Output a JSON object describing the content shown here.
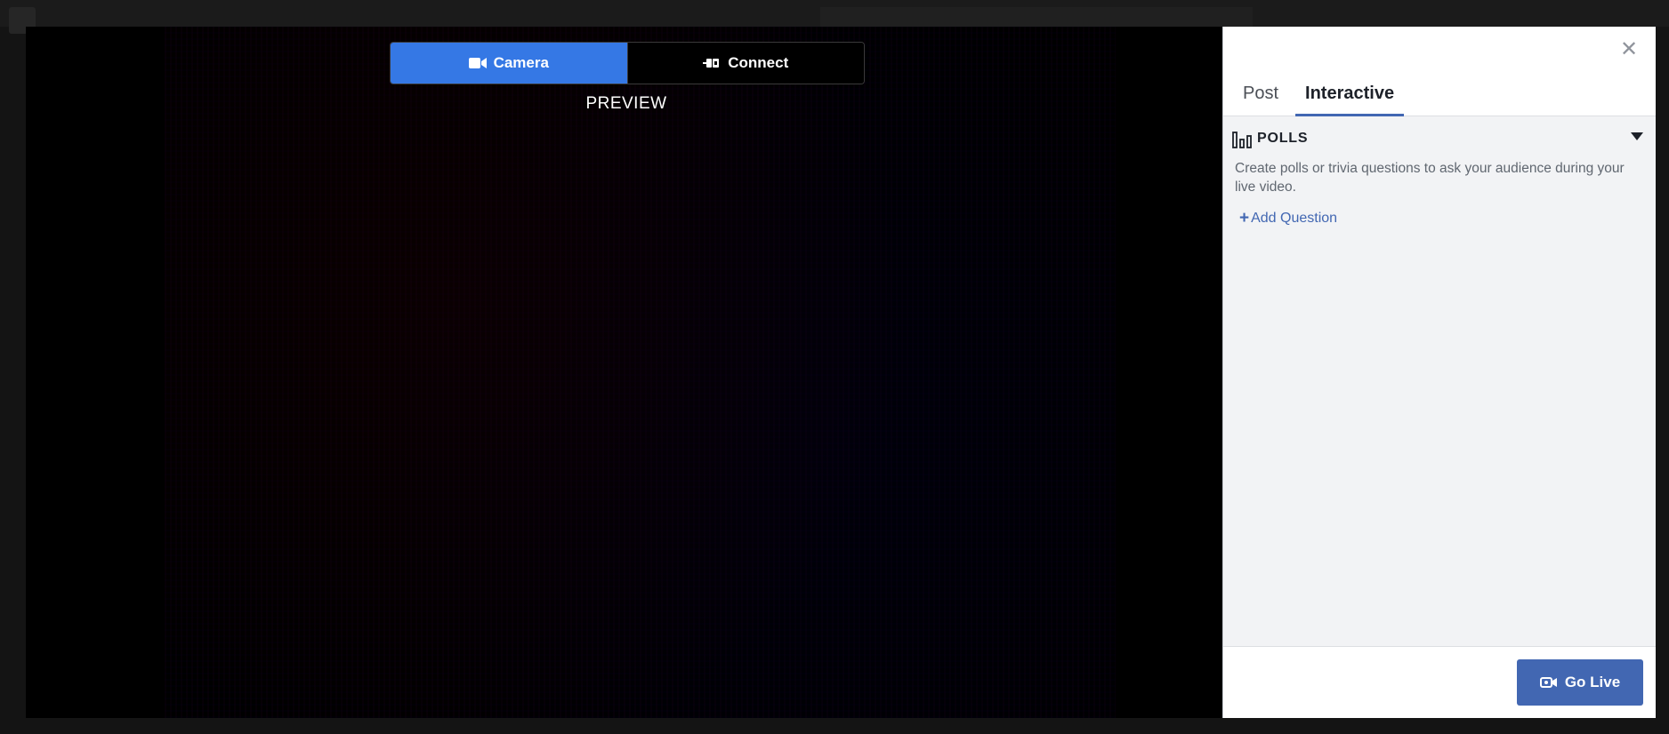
{
  "source_toggle": {
    "camera_label": "Camera",
    "connect_label": "Connect",
    "active": "Camera",
    "active_color": "#3578e5"
  },
  "preview": {
    "label": "PREVIEW"
  },
  "panel": {
    "close_icon": "close-icon",
    "tabs": [
      {
        "label": "Post",
        "active": false
      },
      {
        "label": "Interactive",
        "active": true
      }
    ],
    "polls": {
      "title": "POLLS",
      "description": "Create polls or trivia questions to ask your audience during your live video.",
      "add_question_label": "Add Question"
    },
    "go_live_label": "Go Live",
    "accent_color": "#4267b2"
  }
}
